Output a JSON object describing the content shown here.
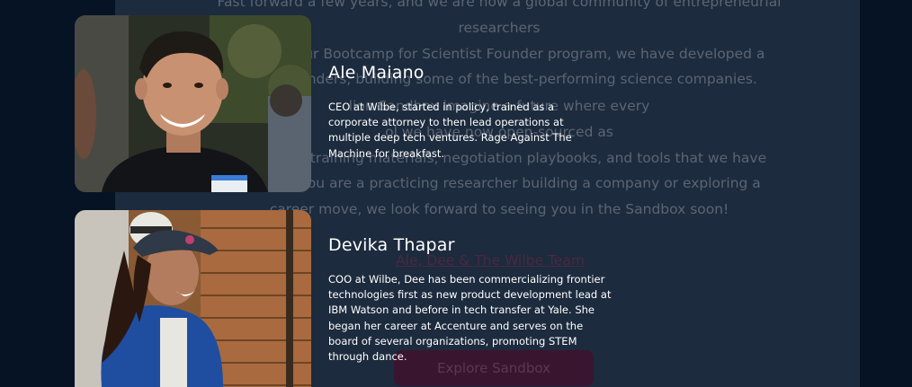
{
  "background": {
    "paragraph1": "Fast forward a few years, and we are now a global community of entrepreneurial researchers\n    Through our Bootcamp for Scientist Founder program, we have developed a\n    entist founders, building some of the best-performing science companies.",
    "paragraph2": "      lion        Sandbox             imagine a future where every\n    ol                                    we have now open-sourced as\n    e business training materials, negotiation playbooks, and tools that we have\n    nders. If you are a practicing researcher building a company or exploring a\n    career move, we look forward to seeing you in the Sandbox soon!",
    "team_link": "Ale, Dee & The Wilbe Team",
    "cta_label": "Explore Sandbox"
  },
  "people": [
    {
      "name": "Ale Maiano",
      "bio": "CEO at Wilbe, started in policy, trained as a corporate attorney to then lead operations at multiple deep tech ventures. Rage Against The Machine for breakfast."
    },
    {
      "name": "Devika Thapar",
      "bio": "COO at Wilbe, Dee has been commercializing frontier technologies first as new product development lead at IBM Watson and before in tech transfer at Yale. She began her career at Accenture and serves on the board of several organizations, promoting STEM through dance."
    }
  ],
  "colors": {
    "page_bg": "#061325",
    "panel_bg": "#1d2b3e",
    "cta_bg": "#3a1530"
  }
}
